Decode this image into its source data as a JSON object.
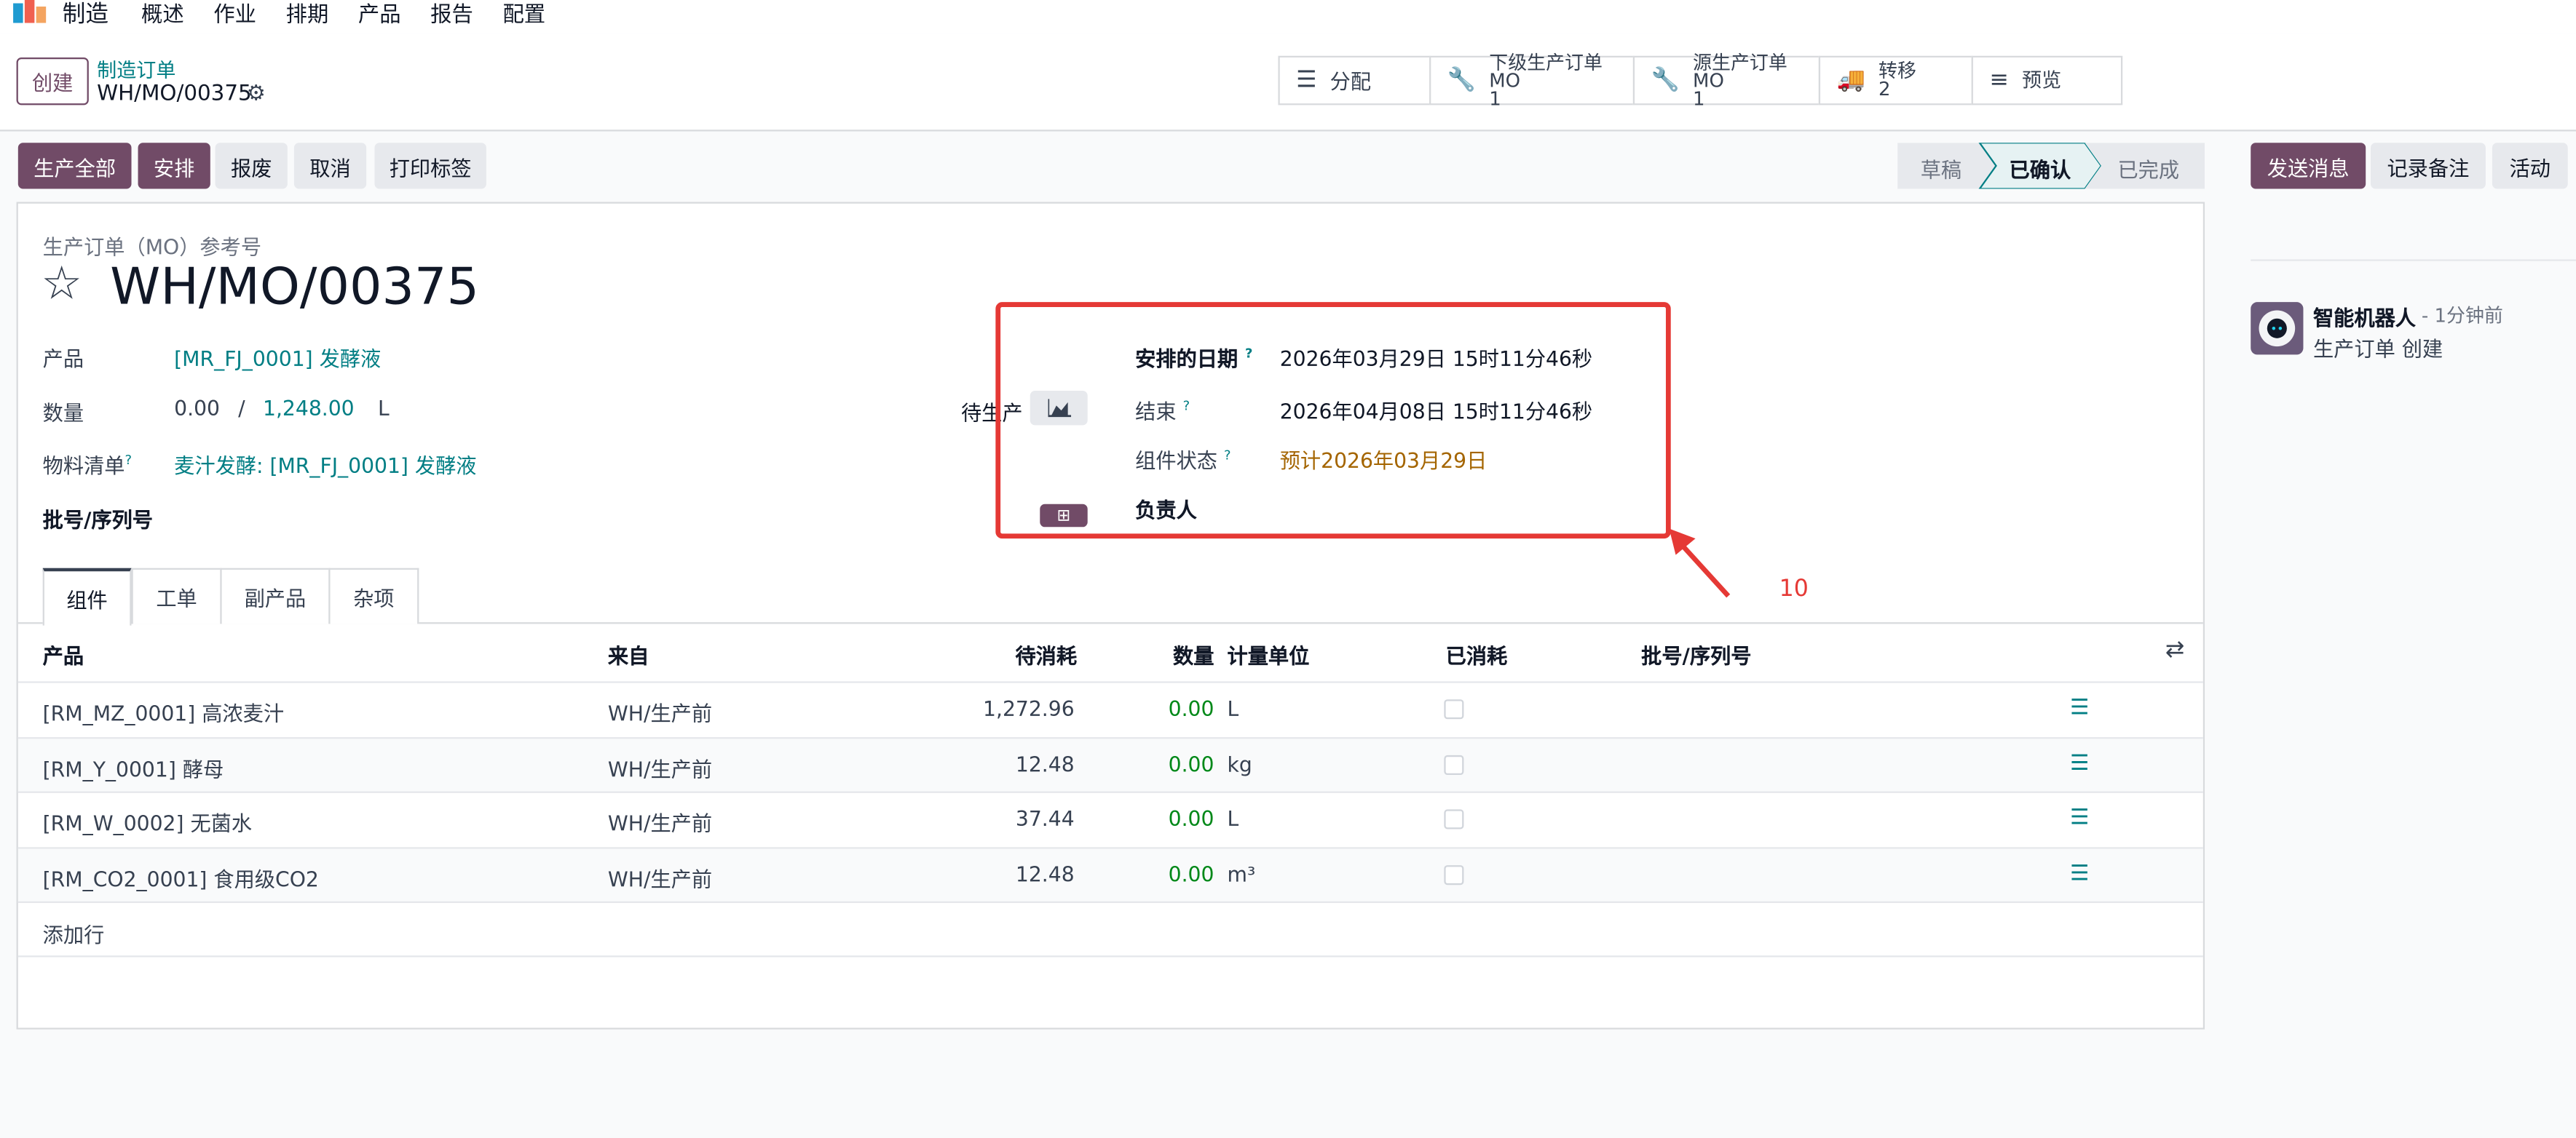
{
  "nav": {
    "app": "制造",
    "items": [
      "概述",
      "作业",
      "排期",
      "产品",
      "报告",
      "配置"
    ]
  },
  "control": {
    "create": "创建",
    "breadcrumb": "制造订单",
    "record": "WH/MO/00375",
    "smart_buttons": [
      {
        "icon": "list-icon",
        "label": "分配",
        "count": ""
      },
      {
        "icon": "wrench-icon",
        "label": "下级生产订单 MO",
        "count": "1"
      },
      {
        "icon": "wrench-icon",
        "label": "源生产订单 MO",
        "count": "1"
      },
      {
        "icon": "truck-icon",
        "label": "转移",
        "count": "2"
      },
      {
        "icon": "menu-icon",
        "label": "预览",
        "count": ""
      }
    ]
  },
  "actions": {
    "produce_all": "生产全部",
    "schedule": "安排",
    "scrap": "报废",
    "cancel": "取消",
    "print": "打印标签"
  },
  "status": {
    "steps": [
      "草稿",
      "已确认",
      "已完成"
    ],
    "active": "已确认"
  },
  "chatter": {
    "send": "发送消息",
    "log": "记录备注",
    "activity": "活动",
    "author": "智能机器人",
    "time": "- 1分钟前",
    "message": "生产订单 创建"
  },
  "form": {
    "ref_label": "生产订单（MO）参考号",
    "title": "WH/MO/00375",
    "product_label": "产品",
    "product_value": "[MR_FJ_0001] 发酵液",
    "qty_label": "数量",
    "qty_done": "0.00",
    "qty_sep": "/",
    "qty_total": "1,248.00",
    "qty_uom": "L",
    "bom_label": "物料清单",
    "bom_value": "麦汁发酵: [MR_FJ_0001] 发酵液",
    "lot_label": "批号/序列号",
    "pending_label": "待生产",
    "scheduled_label": "安排的日期",
    "scheduled_value": "2026年03月29日 15时11分46秒",
    "end_label": "结束",
    "end_value": "2026年04月08日 15时11分46秒",
    "component_status_label": "组件状态",
    "component_status_value": "预计2026年03月29日",
    "responsible_label": "负责人",
    "question_mark": "?"
  },
  "annotation": {
    "number": "10",
    "color": "#e53935"
  },
  "tabs": [
    "组件",
    "工单",
    "副产品",
    "杂项"
  ],
  "table": {
    "headers": {
      "product": "产品",
      "from": "来自",
      "to_consume": "待消耗",
      "qty": "数量",
      "uom": "计量单位",
      "consumed": "已消耗",
      "lot": "批号/序列号"
    },
    "rows": [
      {
        "product": "[RM_MZ_0001] 高浓麦汁",
        "from": "WH/生产前",
        "to_consume": "1,272.96",
        "qty": "0.00",
        "uom": "L"
      },
      {
        "product": "[RM_Y_0001] 酵母",
        "from": "WH/生产前",
        "to_consume": "12.48",
        "qty": "0.00",
        "uom": "kg"
      },
      {
        "product": "[RM_W_0002] 无菌水",
        "from": "WH/生产前",
        "to_consume": "37.44",
        "qty": "0.00",
        "uom": "L"
      },
      {
        "product": "[RM_CO2_0001] 食用级CO2",
        "from": "WH/生产前",
        "to_consume": "12.48",
        "qty": "0.00",
        "uom": "m³"
      }
    ],
    "add_line": "添加行"
  },
  "colors": {
    "brand": "#714b67",
    "link": "#017e84",
    "green": "#008818",
    "warning": "#a46500"
  }
}
